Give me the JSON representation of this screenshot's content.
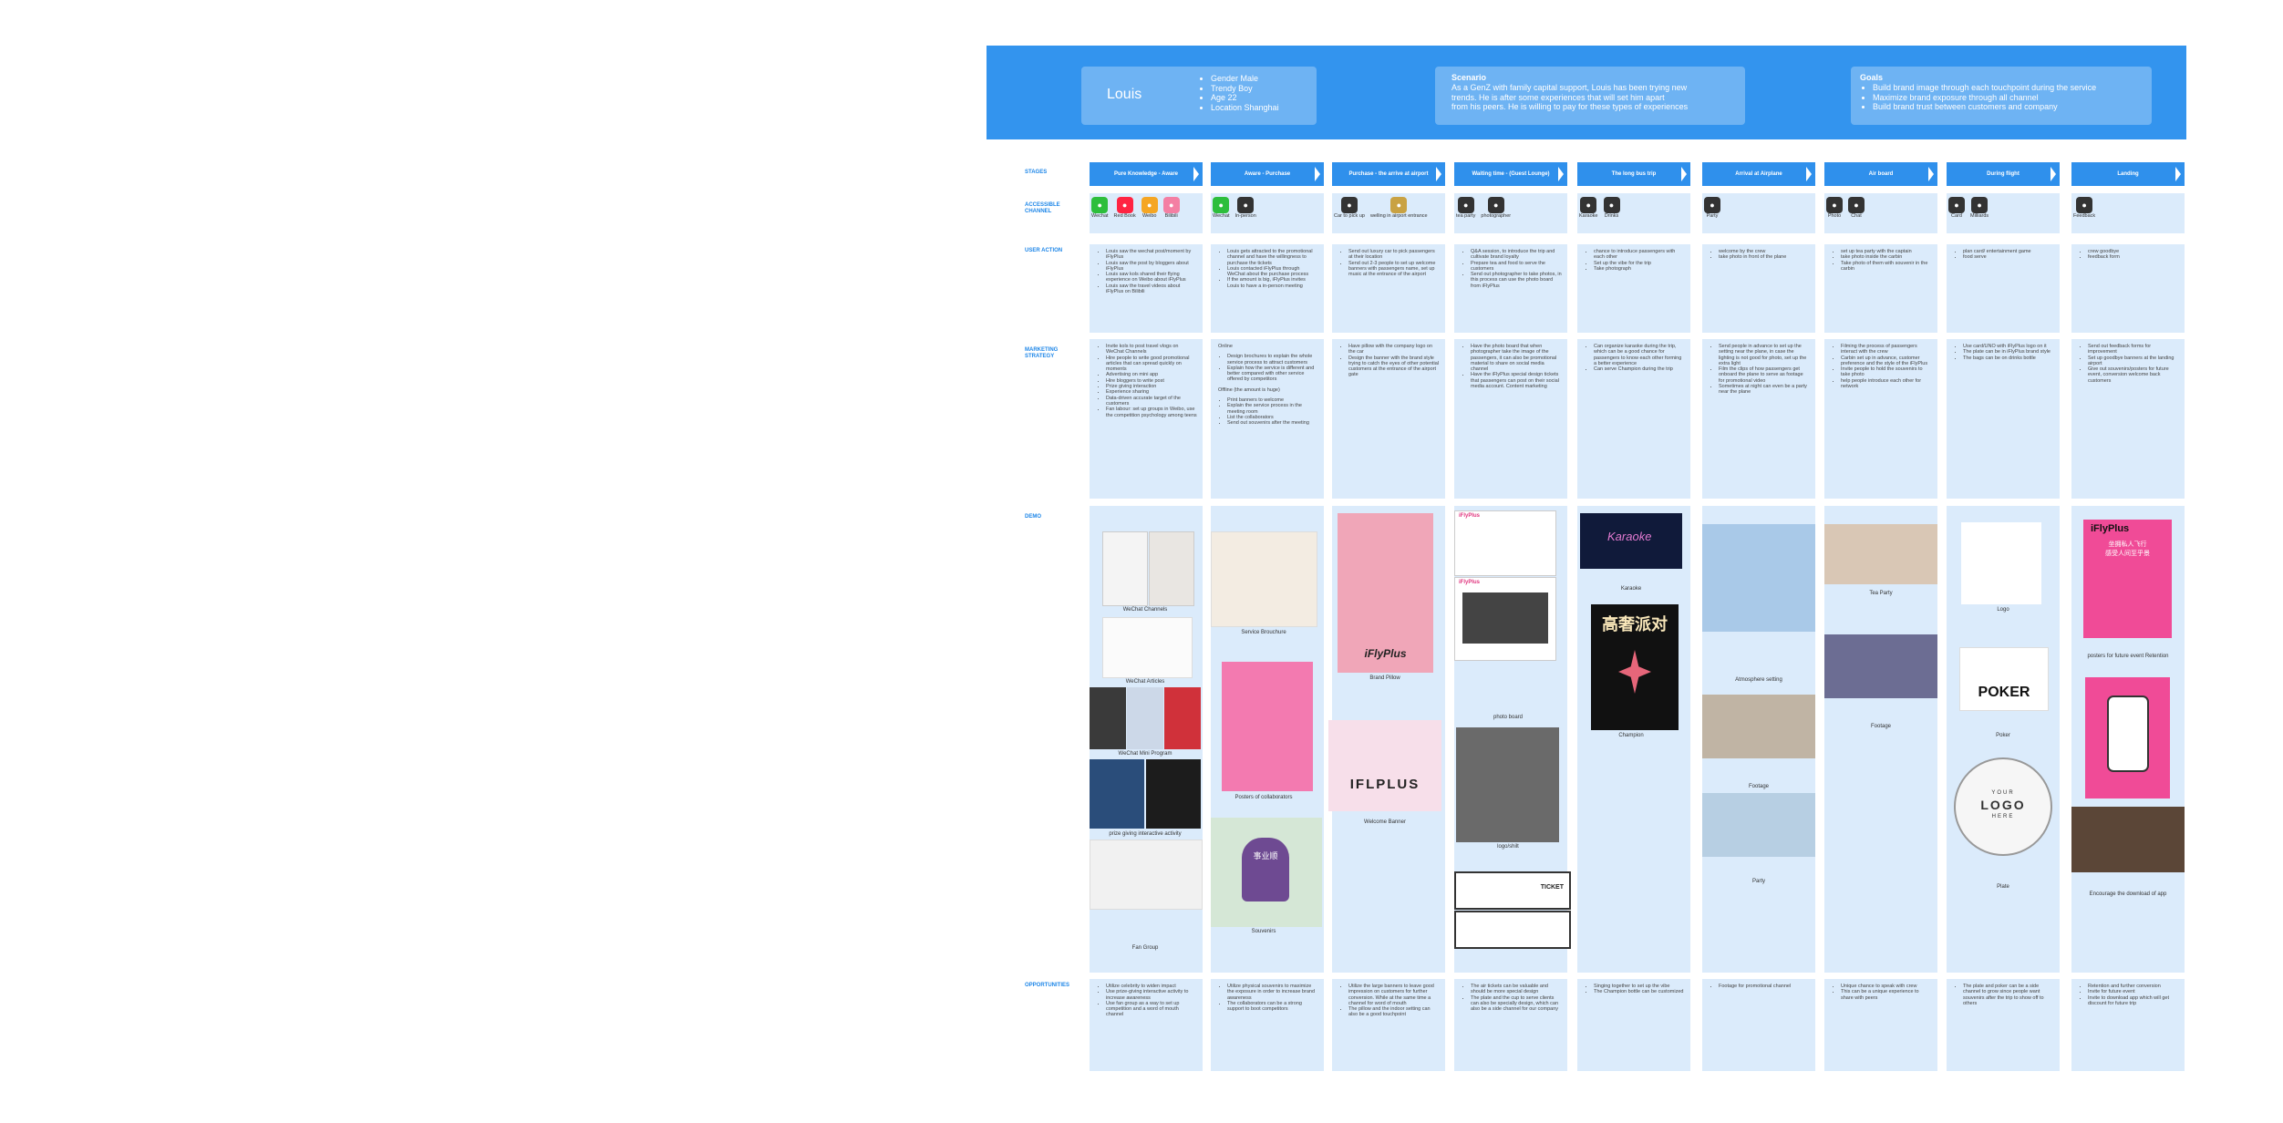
{
  "persona": {
    "name": "Louis",
    "attributes": [
      "Gender Male",
      "Trendy Boy",
      "Age 22",
      "Location Shanghai"
    ]
  },
  "scenario": {
    "title": "Scenario",
    "text": [
      "As a GenZ with family capital support, Louis has been trying new",
      "trends. He is after some experiences that will set him apart",
      "from his peers. He is willing to pay for these types of experiences"
    ]
  },
  "goals": {
    "title": "Goals",
    "items": [
      "Build brand image through each touchpoint during the service",
      "Maximize brand exposure through all channel",
      "Build brand trust between customers and company"
    ]
  },
  "row_labels": {
    "stages": "STAGES",
    "channel": "ACCESSIBLE CHANNEL",
    "action": "USER ACTION",
    "marketing": "MARKETING STRATEGY",
    "demo": "DEMO",
    "opportunities": "OPPORTUNITIES"
  },
  "stages": [
    "Pure Knowledge - Aware",
    "Aware - Purchase",
    "Purchase - the arrive at airport",
    "Waiting time - (Guest Lounge)",
    "The long bus trip",
    "Arrival at Airplane",
    "Air board",
    "During flight",
    "Landing"
  ],
  "channels": [
    [
      {
        "label": "Wechat",
        "icon": "wechat-icon",
        "color": "#2dbe3c"
      },
      {
        "label": "Red Book",
        "icon": "red-book-icon",
        "color": "#ff2442"
      },
      {
        "label": "Weibo",
        "icon": "weibo-icon",
        "color": "#f5a623"
      },
      {
        "label": "Bilibili",
        "icon": "bilibili-icon",
        "color": "#f47fa3"
      }
    ],
    [
      {
        "label": "Wechat",
        "icon": "wechat-icon",
        "color": "#2dbe3c"
      },
      {
        "label": "In-person",
        "icon": "people-icon",
        "color": "#333333"
      }
    ],
    [
      {
        "label": "Car to pick up",
        "icon": "car-icon",
        "color": "#333333"
      },
      {
        "label": "welling in airport entrance",
        "icon": "balloon-icon",
        "color": "#c9a243"
      }
    ],
    [
      {
        "label": "tea party",
        "icon": "tea-icon",
        "color": "#333333"
      },
      {
        "label": "photographer",
        "icon": "photographer-icon",
        "color": "#333333"
      }
    ],
    [
      {
        "label": "Karaoke",
        "icon": "microphone-icon",
        "color": "#333333"
      },
      {
        "label": "Drinks",
        "icon": "drinks-icon",
        "color": "#333333"
      }
    ],
    [
      {
        "label": "Party",
        "icon": "party-icon",
        "color": "#333333"
      }
    ],
    [
      {
        "label": "Photo",
        "icon": "camera-icon",
        "color": "#333333"
      },
      {
        "label": "Chat",
        "icon": "chat-icon",
        "color": "#333333"
      }
    ],
    [
      {
        "label": "Card",
        "icon": "card-icon",
        "color": "#333333"
      },
      {
        "label": "Milliards",
        "icon": "billiards-icon",
        "color": "#333333"
      }
    ],
    [
      {
        "label": "Feedback",
        "icon": "feedback-icon",
        "color": "#333333"
      }
    ]
  ],
  "user_actions": [
    [
      "Louis saw the wechat post/moment by iFlyPlus",
      "Louis saw the post by bloggers about iFlyPlus",
      "Louis saw kols shared their flying experience on Weibo about iFlyPlus",
      "Louis saw the travel videos about iFlyPlus on Bilibili"
    ],
    [
      "Louis gets attracted to the promotional channel and have the willingness to purchase the tickets",
      "Louis contacted iFlyPlus through WeChat about the purchase process",
      "If the amount is big, iFlyPlus invites Louis to have a in-person meeting"
    ],
    [
      "Send out luxury car to pick passengers at their location",
      "Send out 2-3 people to set up welcome banners with passengers name, set up music at the entrance of the airport"
    ],
    [
      "Q&A session, to introduce the trip and cultivate brand loyalty",
      "Prepare tea and food to serve the customers",
      "Send out photographer to take photos, in this process can use the photo board from iFlyPlus"
    ],
    [
      "chance to introduce passengers with each other",
      "Set up the vibe for the trip",
      "Take photograph"
    ],
    [
      "welcome by the crew",
      "take photo in front of the plane"
    ],
    [
      "set up tea party with the captain",
      "take photo inside the carbin",
      "Take photo of them with souvenir in the carbin"
    ],
    [
      "plan card/ entertainment game",
      "food serve"
    ],
    [
      "crew goodbye",
      "feedback form"
    ]
  ],
  "marketing": [
    {
      "items": [
        "Invite kols to post travel vlogs on WeChat Channels",
        "Hire people to write good promotional articles that can spread quickly on moments",
        "Advertising on mini app",
        "Hire bloggers to write post",
        "Prize giving interaction",
        "Experience sharing",
        "Data-driven accurate target of the customers",
        "Fan labour: set up groups in Weibo, use the competition psychology among teens"
      ]
    },
    {
      "intro": "Online",
      "items": [
        "Design brochures to explain the whole service process to attract customers",
        "Explain how the service is different and better compared with other service offered by competitors"
      ],
      "intro2": "Offline (the amount is huge)",
      "items2": [
        "Print banners to welcome",
        "Explain the service process in the meeting room",
        "List the collaborators",
        "Send out souvenirs after the meeting"
      ]
    },
    {
      "items": [
        "Have pillow with the company logo on the car",
        "Design the banner with the brand style trying to catch the eyes of other potential customers at the entrance of the airport gate"
      ]
    },
    {
      "items": [
        "Have the photo board that when photographer take the image of the passengers, it can also be promotional material to share on social media channel",
        "Have the iFlyPlus special design tickets that passengers can post on their social media account. Content marketing"
      ]
    },
    {
      "items": [
        "Can organize karaoke during the trip, which can be a good chance for passengers to know each other forming a better experience",
        "Can serve Champion during the trip"
      ]
    },
    {
      "items": [
        "Send people in advance to set up the setting near the plane, in case the lighting is not good for photo, set up the extra light",
        "Film the clips of how passengers get onboard the plane to serve as footage for promotional video",
        "Sometimes at night can even be a party near the plane"
      ]
    },
    {
      "items": [
        "Filming the process of passengers interact with the crew",
        "Carbin set up in advance, customer preference and the style of the iFlyPlus",
        "Invite people to hold the souvenirs to take photo",
        "help people introduce each other for network"
      ]
    },
    {
      "items": [
        "Use card/UNO with iFlyPlus logo on it",
        "The plate can be in iFlyPlus brand style",
        "The bags can be on drinks bottle"
      ]
    },
    {
      "items": [
        "Send out feedback forms for improvement",
        "Set up goodbye banners at the landing airport",
        "Give out souvenirs/posters for future event, conversion welcome back customers"
      ]
    }
  ],
  "demo_captions": [
    [
      "WeChat Channels",
      "WeChat Articles",
      "WeChat Mini Program",
      "prize giving interactive activity",
      "Fan Group"
    ],
    [
      "Service Brouchure",
      "Posters of collaborators",
      "Souvenirs"
    ],
    [
      "Brand Pillow",
      "Welcome Banner"
    ],
    [
      "photo board",
      "logo/shilt"
    ],
    [
      "Karaoke",
      "Champion"
    ],
    [
      "Atmosphere setting",
      "Footage",
      "Party"
    ],
    [
      "Tea Party",
      "Footage"
    ],
    [
      "Logo",
      "Poker",
      "Plate"
    ],
    [
      "posters for future event Retention",
      "Encourage the download of app"
    ]
  ],
  "demo_texts": {
    "pillow_brand": "iFlyPlus",
    "banner_brand": "IFLPLUS",
    "karaoke": "Karaoke",
    "champion_title": "高奢派对",
    "poker": "POKER",
    "plate_logo": "LOGO",
    "plate_your": "YOUR",
    "plate_here": "HERE",
    "poster_brand": "iFlyPlus",
    "poster_line1": "坐拥私人飞行",
    "poster_line2": "感受人间至乎景",
    "ticket_word": "TICKET",
    "ifp": "iFlyPlus",
    "souvenir_text": "事业顺"
  },
  "opportunities": [
    [
      "Utilize celebrity to widen impact",
      "Use prize-giving interactive activity to increase awareness",
      "Use fan group as a way to set up competition and a word of mouth channel"
    ],
    [
      "Utilize physical souvenirs to maximize the exposure in order to increase brand awareness",
      "The collaborators can be a strong support to boot competitors"
    ],
    [
      "Utilize the large banners to leave good impression on customers for further conversion. While at the same time a channel for word of mouth",
      "The pillow and the indoor setting can also be a good touchpoint"
    ],
    [
      "The air tickets can be valuable and should be more special design",
      "The plate and the cup to serve clients can also be specially design, which can also be a side channel for our company"
    ],
    [
      "Singing together to set up the vibe",
      "The Champion bottle can be customized"
    ],
    [
      "Footage for promotional channel"
    ],
    [
      "Unique chance to speak with crew",
      "This can be a unique experience to share with peers"
    ],
    [
      "The plate and poker can be a side channel to grow since people want souvenirs after the trip to show off to others"
    ],
    [
      "Retention and further conversion",
      "Invite for future event",
      "Invite to download app which will get discount for future trip"
    ]
  ],
  "colors": {
    "banner": "#3394ee",
    "card": "#6eb3f3",
    "cell": "#dbebfb",
    "stage": "#2f90ec",
    "label": "#1d86e8",
    "pink": "#f04b97"
  }
}
